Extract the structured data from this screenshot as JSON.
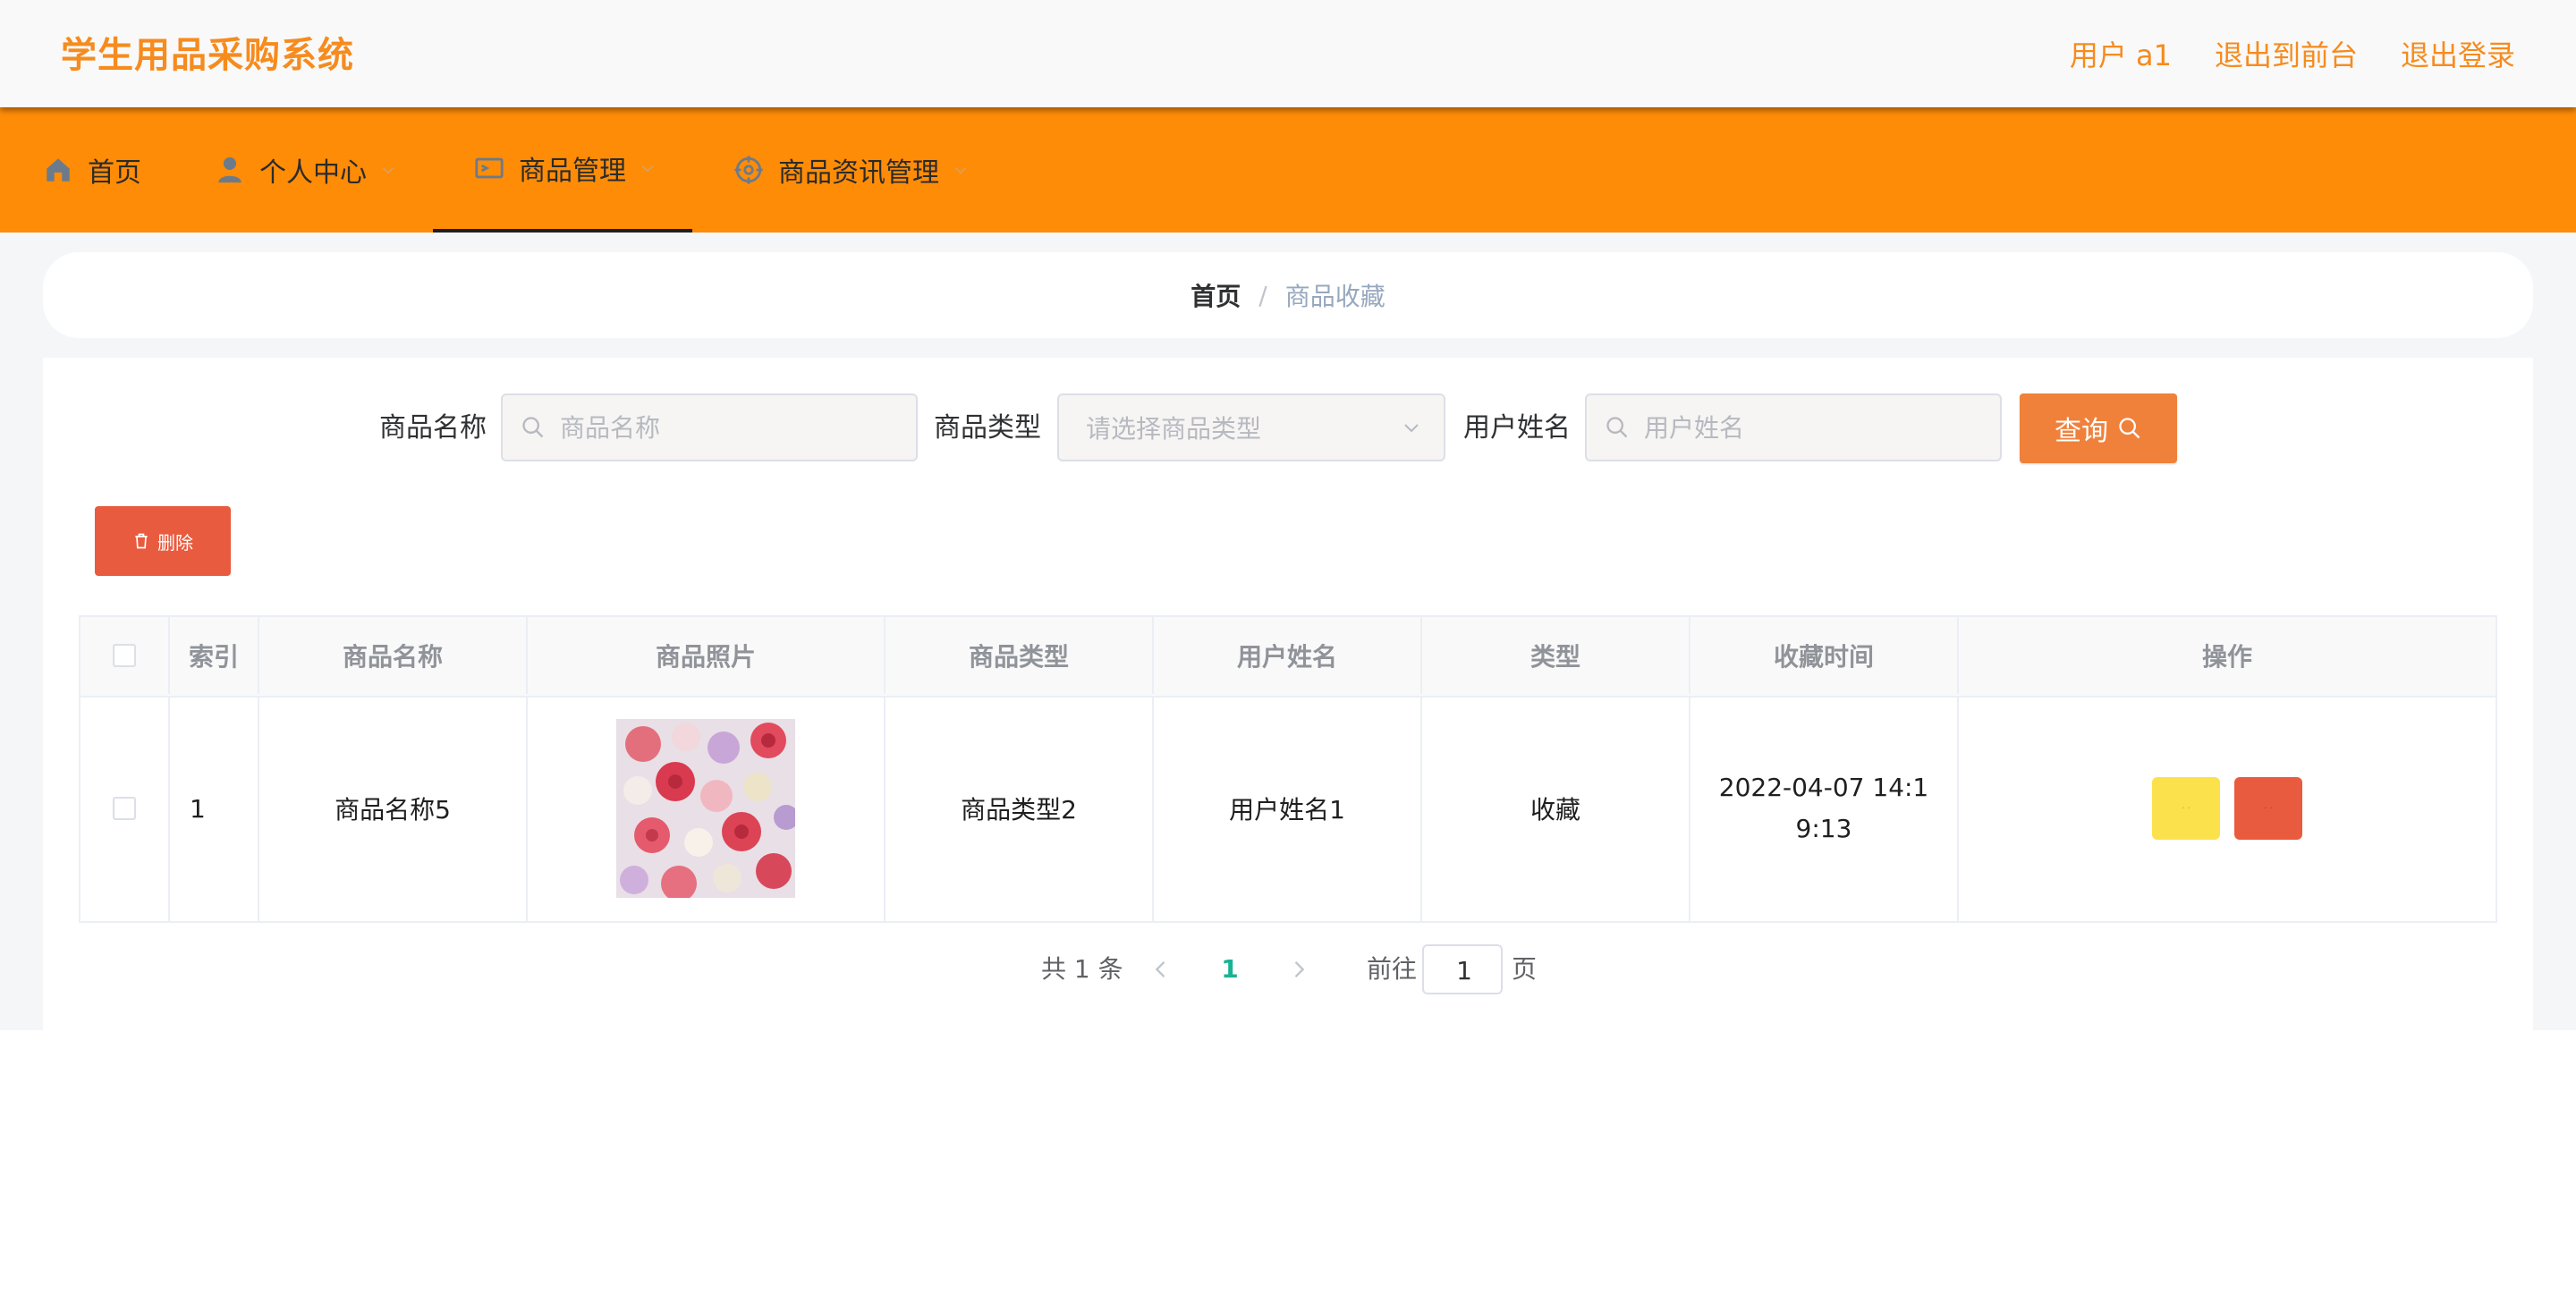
{
  "header": {
    "app_title": "学生用品采购系统",
    "user_label": "用户 a1",
    "back_front_label": "退出到前台",
    "logout_label": "退出登录"
  },
  "nav": {
    "items": [
      {
        "label": "首页",
        "icon": "home-icon",
        "has_submenu": false
      },
      {
        "label": "个人中心",
        "icon": "user-icon",
        "has_submenu": true
      },
      {
        "label": "商品管理",
        "icon": "product-icon",
        "has_submenu": true,
        "active": true
      },
      {
        "label": "商品资讯管理",
        "icon": "news-icon",
        "has_submenu": true
      }
    ]
  },
  "breadcrumb": {
    "home": "首页",
    "separator": "/",
    "current": "商品收藏"
  },
  "search": {
    "product_name_label": "商品名称",
    "product_name_placeholder": "商品名称",
    "product_type_label": "商品类型",
    "product_type_placeholder": "请选择商品类型",
    "user_name_label": "用户姓名",
    "user_name_placeholder": "用户姓名",
    "query_button": "查询"
  },
  "actions": {
    "delete_button": "删除"
  },
  "table": {
    "columns": [
      "索引",
      "商品名称",
      "商品照片",
      "商品类型",
      "用户姓名",
      "类型",
      "收藏时间",
      "操作"
    ],
    "rows": [
      {
        "index": "1",
        "product_name": "商品名称5",
        "product_type": "商品类型2",
        "user_name": "用户姓名1",
        "type": "收藏",
        "time": "2022-04-07 14:19:13"
      }
    ]
  },
  "pagination": {
    "total_text": "共 1 条",
    "current_page": "1",
    "goto_label": "前往",
    "goto_value": "1",
    "page_suffix": "页"
  },
  "colors": {
    "brand": "#ff8c07",
    "title": "#f68b1e",
    "query_button": "#f0813b",
    "delete_button": "#e95b3f",
    "edit_button": "#fbe14c",
    "page_active": "#19b394"
  }
}
